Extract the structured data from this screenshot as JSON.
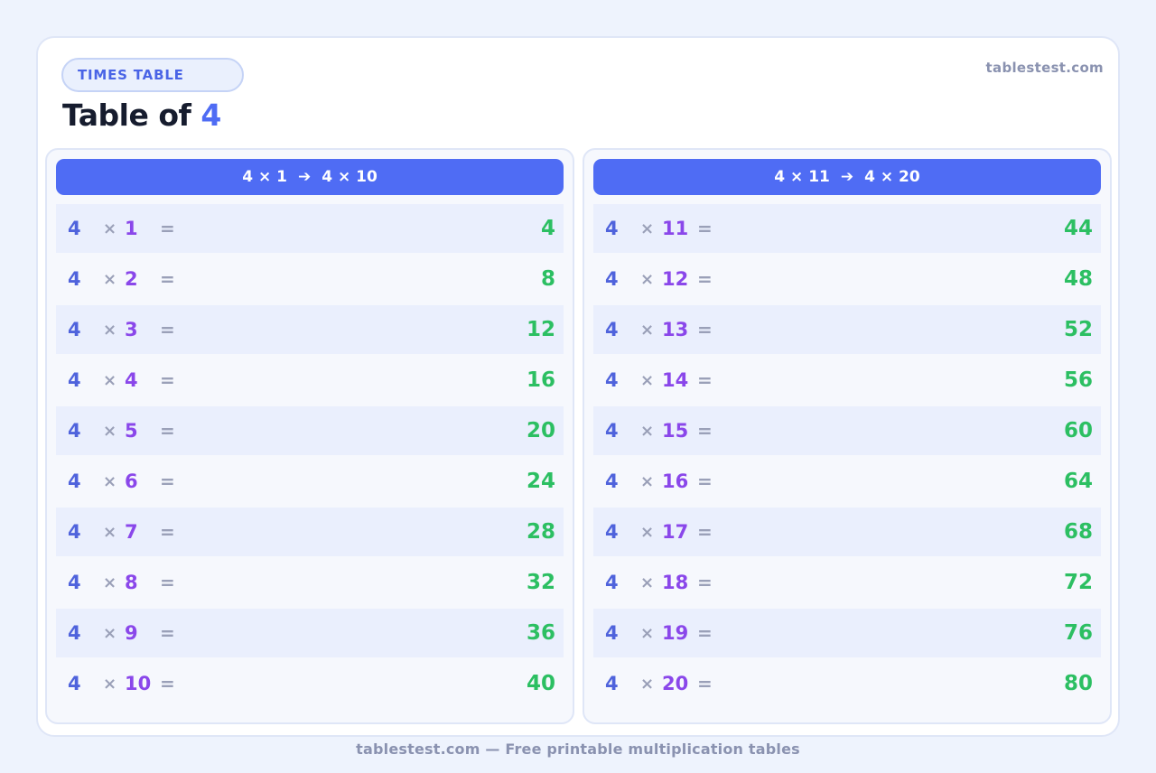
{
  "badge": "TIMES TABLE",
  "site": "tablestest.com",
  "title": {
    "prefix": "Table of",
    "number": "4"
  },
  "panels": [
    {
      "header": {
        "from": "4 × 1",
        "arrow": "➔",
        "to": "4 × 10"
      },
      "rows": [
        {
          "a": "4",
          "op": "×",
          "b": "1",
          "eq": "=",
          "result": "4"
        },
        {
          "a": "4",
          "op": "×",
          "b": "2",
          "eq": "=",
          "result": "8"
        },
        {
          "a": "4",
          "op": "×",
          "b": "3",
          "eq": "=",
          "result": "12"
        },
        {
          "a": "4",
          "op": "×",
          "b": "4",
          "eq": "=",
          "result": "16"
        },
        {
          "a": "4",
          "op": "×",
          "b": "5",
          "eq": "=",
          "result": "20"
        },
        {
          "a": "4",
          "op": "×",
          "b": "6",
          "eq": "=",
          "result": "24"
        },
        {
          "a": "4",
          "op": "×",
          "b": "7",
          "eq": "=",
          "result": "28"
        },
        {
          "a": "4",
          "op": "×",
          "b": "8",
          "eq": "=",
          "result": "32"
        },
        {
          "a": "4",
          "op": "×",
          "b": "9",
          "eq": "=",
          "result": "36"
        },
        {
          "a": "4",
          "op": "×",
          "b": "10",
          "eq": "=",
          "result": "40"
        }
      ]
    },
    {
      "header": {
        "from": "4 × 11",
        "arrow": "➔",
        "to": "4 × 20"
      },
      "rows": [
        {
          "a": "4",
          "op": "×",
          "b": "11",
          "eq": "=",
          "result": "44"
        },
        {
          "a": "4",
          "op": "×",
          "b": "12",
          "eq": "=",
          "result": "48"
        },
        {
          "a": "4",
          "op": "×",
          "b": "13",
          "eq": "=",
          "result": "52"
        },
        {
          "a": "4",
          "op": "×",
          "b": "14",
          "eq": "=",
          "result": "56"
        },
        {
          "a": "4",
          "op": "×",
          "b": "15",
          "eq": "=",
          "result": "60"
        },
        {
          "a": "4",
          "op": "×",
          "b": "16",
          "eq": "=",
          "result": "64"
        },
        {
          "a": "4",
          "op": "×",
          "b": "17",
          "eq": "=",
          "result": "68"
        },
        {
          "a": "4",
          "op": "×",
          "b": "18",
          "eq": "=",
          "result": "72"
        },
        {
          "a": "4",
          "op": "×",
          "b": "19",
          "eq": "=",
          "result": "76"
        },
        {
          "a": "4",
          "op": "×",
          "b": "20",
          "eq": "=",
          "result": "80"
        }
      ]
    }
  ],
  "footer": "tablestest.com — Free printable multiplication tables",
  "colors": {
    "accent": "#4f6cf4",
    "multiplicand": "#4f63dc",
    "multiplier": "#8a47ea",
    "result": "#2cbf62",
    "operator": "#9aa0b8"
  }
}
